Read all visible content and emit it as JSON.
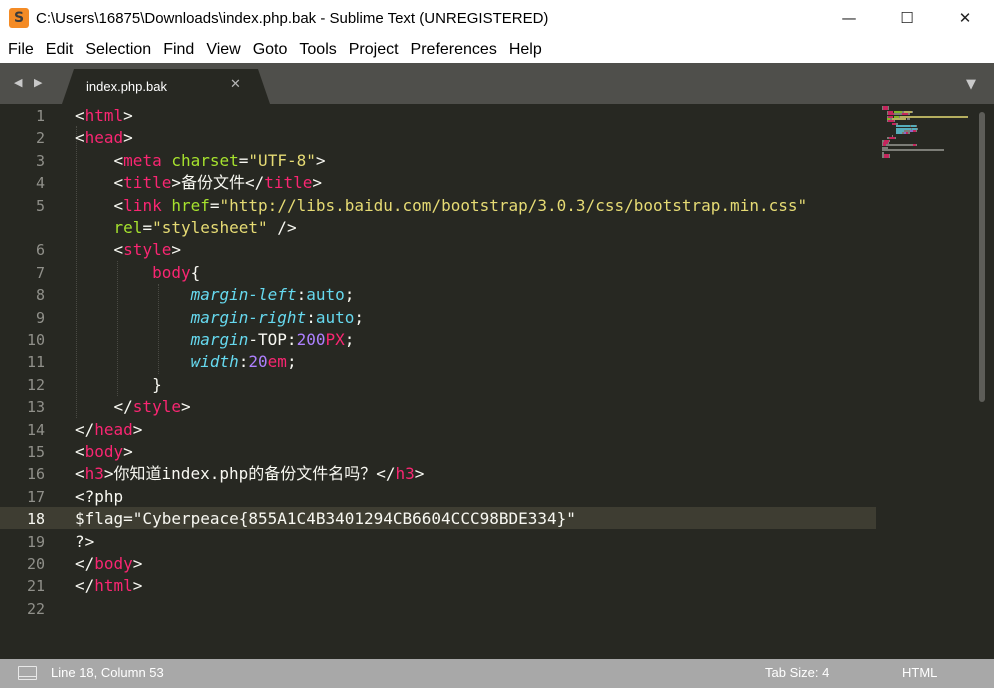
{
  "window": {
    "title": "C:\\Users\\16875\\Downloads\\index.php.bak - Sublime Text (UNREGISTERED)",
    "app_icon": "S",
    "controls": {
      "minimize": "—",
      "maximize": "☐",
      "close": "✕"
    }
  },
  "menu": [
    "File",
    "Edit",
    "Selection",
    "Find",
    "View",
    "Goto",
    "Tools",
    "Project",
    "Preferences",
    "Help"
  ],
  "tabs": {
    "nav_arrows": "◀ ▶",
    "active_tab": "index.php.bak",
    "close_glyph": "✕",
    "dropdown_glyph": "▼"
  },
  "editor": {
    "line_numbers": [
      "1",
      "2",
      "3",
      "4",
      "5",
      "",
      "6",
      "7",
      "8",
      "9",
      "10",
      "11",
      "12",
      "13",
      "14",
      "15",
      "16",
      "17",
      "18",
      "19",
      "20",
      "21",
      "22"
    ],
    "highlighted_line": 18,
    "lines": [
      [
        [
          "p",
          "<"
        ],
        [
          "t",
          "html"
        ],
        [
          "p",
          ">"
        ]
      ],
      [
        [
          "p",
          "<"
        ],
        [
          "t",
          "head"
        ],
        [
          "p",
          ">"
        ]
      ],
      [
        [
          "p",
          "    <"
        ],
        [
          "t",
          "meta"
        ],
        [
          "p",
          " "
        ],
        [
          "a",
          "charset"
        ],
        [
          "p",
          "="
        ],
        [
          "s",
          "\"UTF-8\""
        ],
        [
          "p",
          ">"
        ]
      ],
      [
        [
          "p",
          "    <"
        ],
        [
          "t",
          "title"
        ],
        [
          "p",
          ">备份文件</"
        ],
        [
          "t",
          "title"
        ],
        [
          "p",
          ">"
        ]
      ],
      [
        [
          "p",
          "    <"
        ],
        [
          "t",
          "link"
        ],
        [
          "p",
          " "
        ],
        [
          "a",
          "href"
        ],
        [
          "p",
          "="
        ],
        [
          "s",
          "\"http://libs.baidu.com/bootstrap/3.0.3/css/bootstrap.min.css\""
        ]
      ],
      [
        [
          "p",
          "    "
        ],
        [
          "a",
          "rel"
        ],
        [
          "p",
          "="
        ],
        [
          "s",
          "\"stylesheet\""
        ],
        [
          "p",
          " />"
        ]
      ],
      [
        [
          "p",
          "    <"
        ],
        [
          "t",
          "style"
        ],
        [
          "p",
          ">"
        ]
      ],
      [
        [
          "p",
          "        "
        ],
        [
          "t",
          "body"
        ],
        [
          "p",
          "{"
        ]
      ],
      [
        [
          "p",
          "            "
        ],
        [
          "v",
          "margin-left"
        ],
        [
          "p",
          ":"
        ],
        [
          "c",
          "auto"
        ],
        [
          "p",
          ";"
        ]
      ],
      [
        [
          "p",
          "            "
        ],
        [
          "v",
          "margin-right"
        ],
        [
          "p",
          ":"
        ],
        [
          "c",
          "auto"
        ],
        [
          "p",
          ";"
        ]
      ],
      [
        [
          "p",
          "            "
        ],
        [
          "v",
          "margin"
        ],
        [
          "p",
          "-TOP:"
        ],
        [
          "n",
          "200"
        ],
        [
          "t",
          "PX"
        ],
        [
          "p",
          ";"
        ]
      ],
      [
        [
          "p",
          "            "
        ],
        [
          "v",
          "width"
        ],
        [
          "p",
          ":"
        ],
        [
          "n",
          "20"
        ],
        [
          "t",
          "em"
        ],
        [
          "p",
          ";"
        ]
      ],
      [
        [
          "p",
          "        }"
        ]
      ],
      [
        [
          "p",
          "    </"
        ],
        [
          "t",
          "style"
        ],
        [
          "p",
          ">"
        ]
      ],
      [
        [
          "p",
          "</"
        ],
        [
          "t",
          "head"
        ],
        [
          "p",
          ">"
        ]
      ],
      [
        [
          "p",
          "<"
        ],
        [
          "t",
          "body"
        ],
        [
          "p",
          ">"
        ]
      ],
      [
        [
          "p",
          "<"
        ],
        [
          "t",
          "h3"
        ],
        [
          "p",
          ">你知道index.php的备份文件名吗？</"
        ],
        [
          "t",
          "h3"
        ],
        [
          "p",
          ">"
        ]
      ],
      [
        [
          "p",
          "<?php"
        ]
      ],
      [
        [
          "p",
          "$flag=\"Cyberpeace{855A1C4B3401294CB6604CCC98BDE334}\""
        ]
      ],
      [
        [
          "p",
          "?>"
        ]
      ],
      [
        [
          "p",
          "</"
        ],
        [
          "t",
          "body"
        ],
        [
          "p",
          ">"
        ]
      ],
      [
        [
          "p",
          "</"
        ],
        [
          "t",
          "html"
        ],
        [
          "p",
          ">"
        ]
      ],
      [
        [
          "p",
          ""
        ]
      ]
    ]
  },
  "status": {
    "position": "Line 18, Column 53",
    "tab_size": "Tab Size: 4",
    "syntax": "HTML"
  },
  "colors": {
    "editor_bg": "#272822",
    "tag": "#f92672",
    "attr": "#a6e22e",
    "string": "#e6db74",
    "property": "#66d9ef",
    "number": "#ae81ff",
    "statusbar": "#a8a8a8"
  }
}
